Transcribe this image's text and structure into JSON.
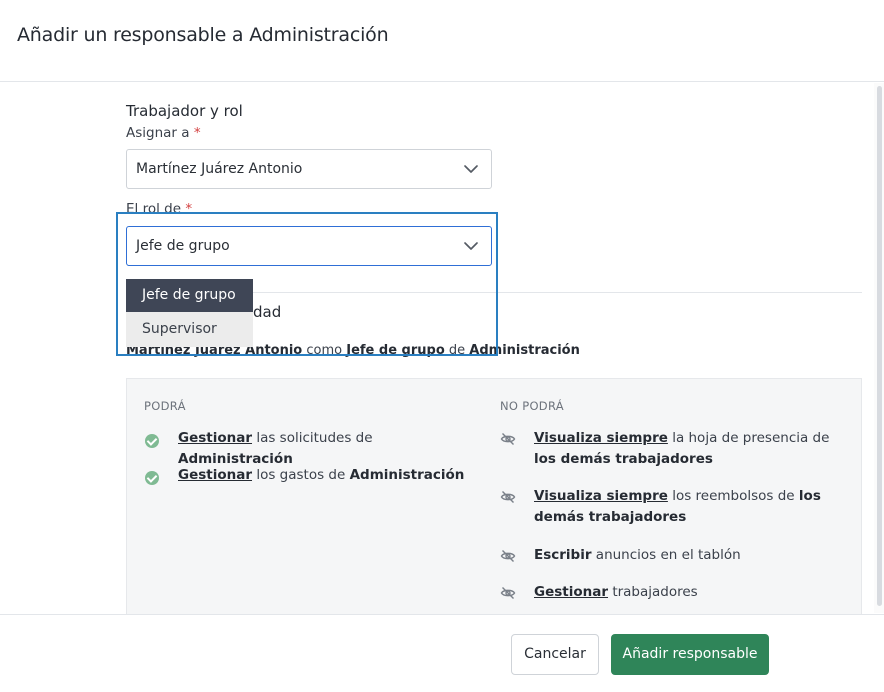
{
  "modal": {
    "title": "Añadir un responsable a Administración"
  },
  "form": {
    "section_title": "Trabajador y rol",
    "assign_label": "Asignar a",
    "assign_value": "Martínez Juárez Antonio",
    "role_label": "El rol de",
    "role_value": "Jefe de grupo",
    "required_mark": "*"
  },
  "dropdown": {
    "options": [
      "Jefe de grupo",
      "Supervisor"
    ],
    "selected": "Jefe de grupo"
  },
  "responsibility": {
    "title_visible_tail": "dad",
    "summary": {
      "worker": "Martínez Juárez Antonio",
      "as": "como",
      "role": "Jefe de grupo",
      "of": "de",
      "department": "Administración"
    }
  },
  "permissions": {
    "can_header": "PODRÁ",
    "cannot_header": "NO PODRÁ",
    "can": [
      {
        "action": "Gestionar",
        "text": "las solicitudes de",
        "target": "Administración"
      },
      {
        "action": "Gestionar",
        "text": "los gastos de",
        "target": "Administración"
      }
    ],
    "cannot": [
      {
        "action": "Visualiza siempre",
        "text": "la hoja de presencia de",
        "target": "los demás trabajadores"
      },
      {
        "action": "Visualiza siempre",
        "text": "los reembolsos de",
        "target": "los demás trabajadores"
      },
      {
        "action": "Escribir",
        "text": "anuncios en el tablón",
        "target": ""
      },
      {
        "action": "Gestionar",
        "text": "trabajadores",
        "target": ""
      }
    ]
  },
  "footer": {
    "cancel_label": "Cancelar",
    "submit_label": "Añadir responsable"
  },
  "colors": {
    "primary_green": "#2f8559",
    "check_green": "#7fba93",
    "selected_option_bg": "#3f4656",
    "highlight_border": "#2a7fc1",
    "required_red": "#d33f3f"
  },
  "icons": {
    "can": "check-circle-icon",
    "cannot": "eye-slash-icon",
    "select": "chevron-down-icon"
  }
}
